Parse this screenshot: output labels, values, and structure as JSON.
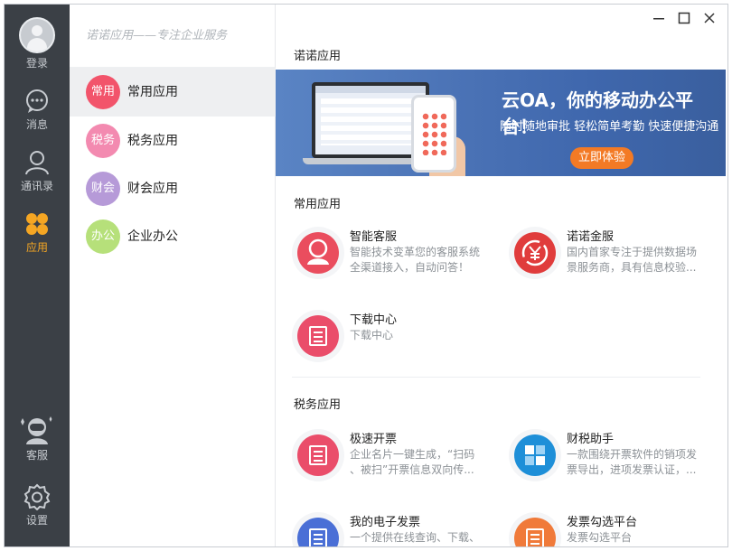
{
  "sidebar": {
    "login_label": "登录",
    "messages_label": "消息",
    "contacts_label": "通讯录",
    "apps_label": "应用",
    "support_label": "客服",
    "settings_label": "设置"
  },
  "categories": {
    "slogan": "诺诺应用——专注企业服务",
    "items": [
      {
        "badge": "常用",
        "label": "常用应用",
        "color": "#f2546b"
      },
      {
        "badge": "税务",
        "label": "税务应用",
        "color": "#f38ab0"
      },
      {
        "badge": "财会",
        "label": "财会应用",
        "color": "#b69ad8"
      },
      {
        "badge": "办公",
        "label": "企业办公",
        "color": "#b6e07a"
      }
    ]
  },
  "main": {
    "section_top": "诺诺应用",
    "banner": {
      "headline": "云OA，你的移动办公平台！",
      "sub": "随时随地审批 轻松简单考勤 快速便捷沟通",
      "cta": "立即体验"
    },
    "section_common": "常用应用",
    "section_tax": "税务应用",
    "common_apps": [
      {
        "title": "智能客服",
        "desc": "智能技术变革您的客服系统\n全渠道接入，自动问答！",
        "icon": "support-agent-icon",
        "color": "#ea4d5e"
      },
      {
        "title": "诺诺金服",
        "desc": "国内首家专注于提供数据场\n景服务商，具有信息校验...",
        "icon": "yuan-exchange-icon",
        "color": "#e03c3c"
      },
      {
        "title": "下载中心",
        "desc": "下载中心",
        "icon": "document-rocket-icon",
        "color": "#ea4d6a"
      }
    ],
    "tax_apps": [
      {
        "title": "极速开票",
        "desc": "企业名片一键生成，“扫码\n、被扫”开票信息双向传...",
        "icon": "invoice-rocket-icon",
        "color": "#ea4d6a"
      },
      {
        "title": "财税助手",
        "desc": "一款围绕开票软件的销项发\n票导出，进项发票认证，...",
        "icon": "tax-assistant-icon",
        "color": "#1e8fd8"
      },
      {
        "title": "我的电子发票",
        "desc": "一个提供在线查询、下载、",
        "icon": "e-invoice-icon",
        "color": "#4a6fd6"
      },
      {
        "title": "发票勾选平台",
        "desc": "发票勾选平台",
        "icon": "invoice-check-icon",
        "color": "#f07a3a"
      }
    ]
  }
}
